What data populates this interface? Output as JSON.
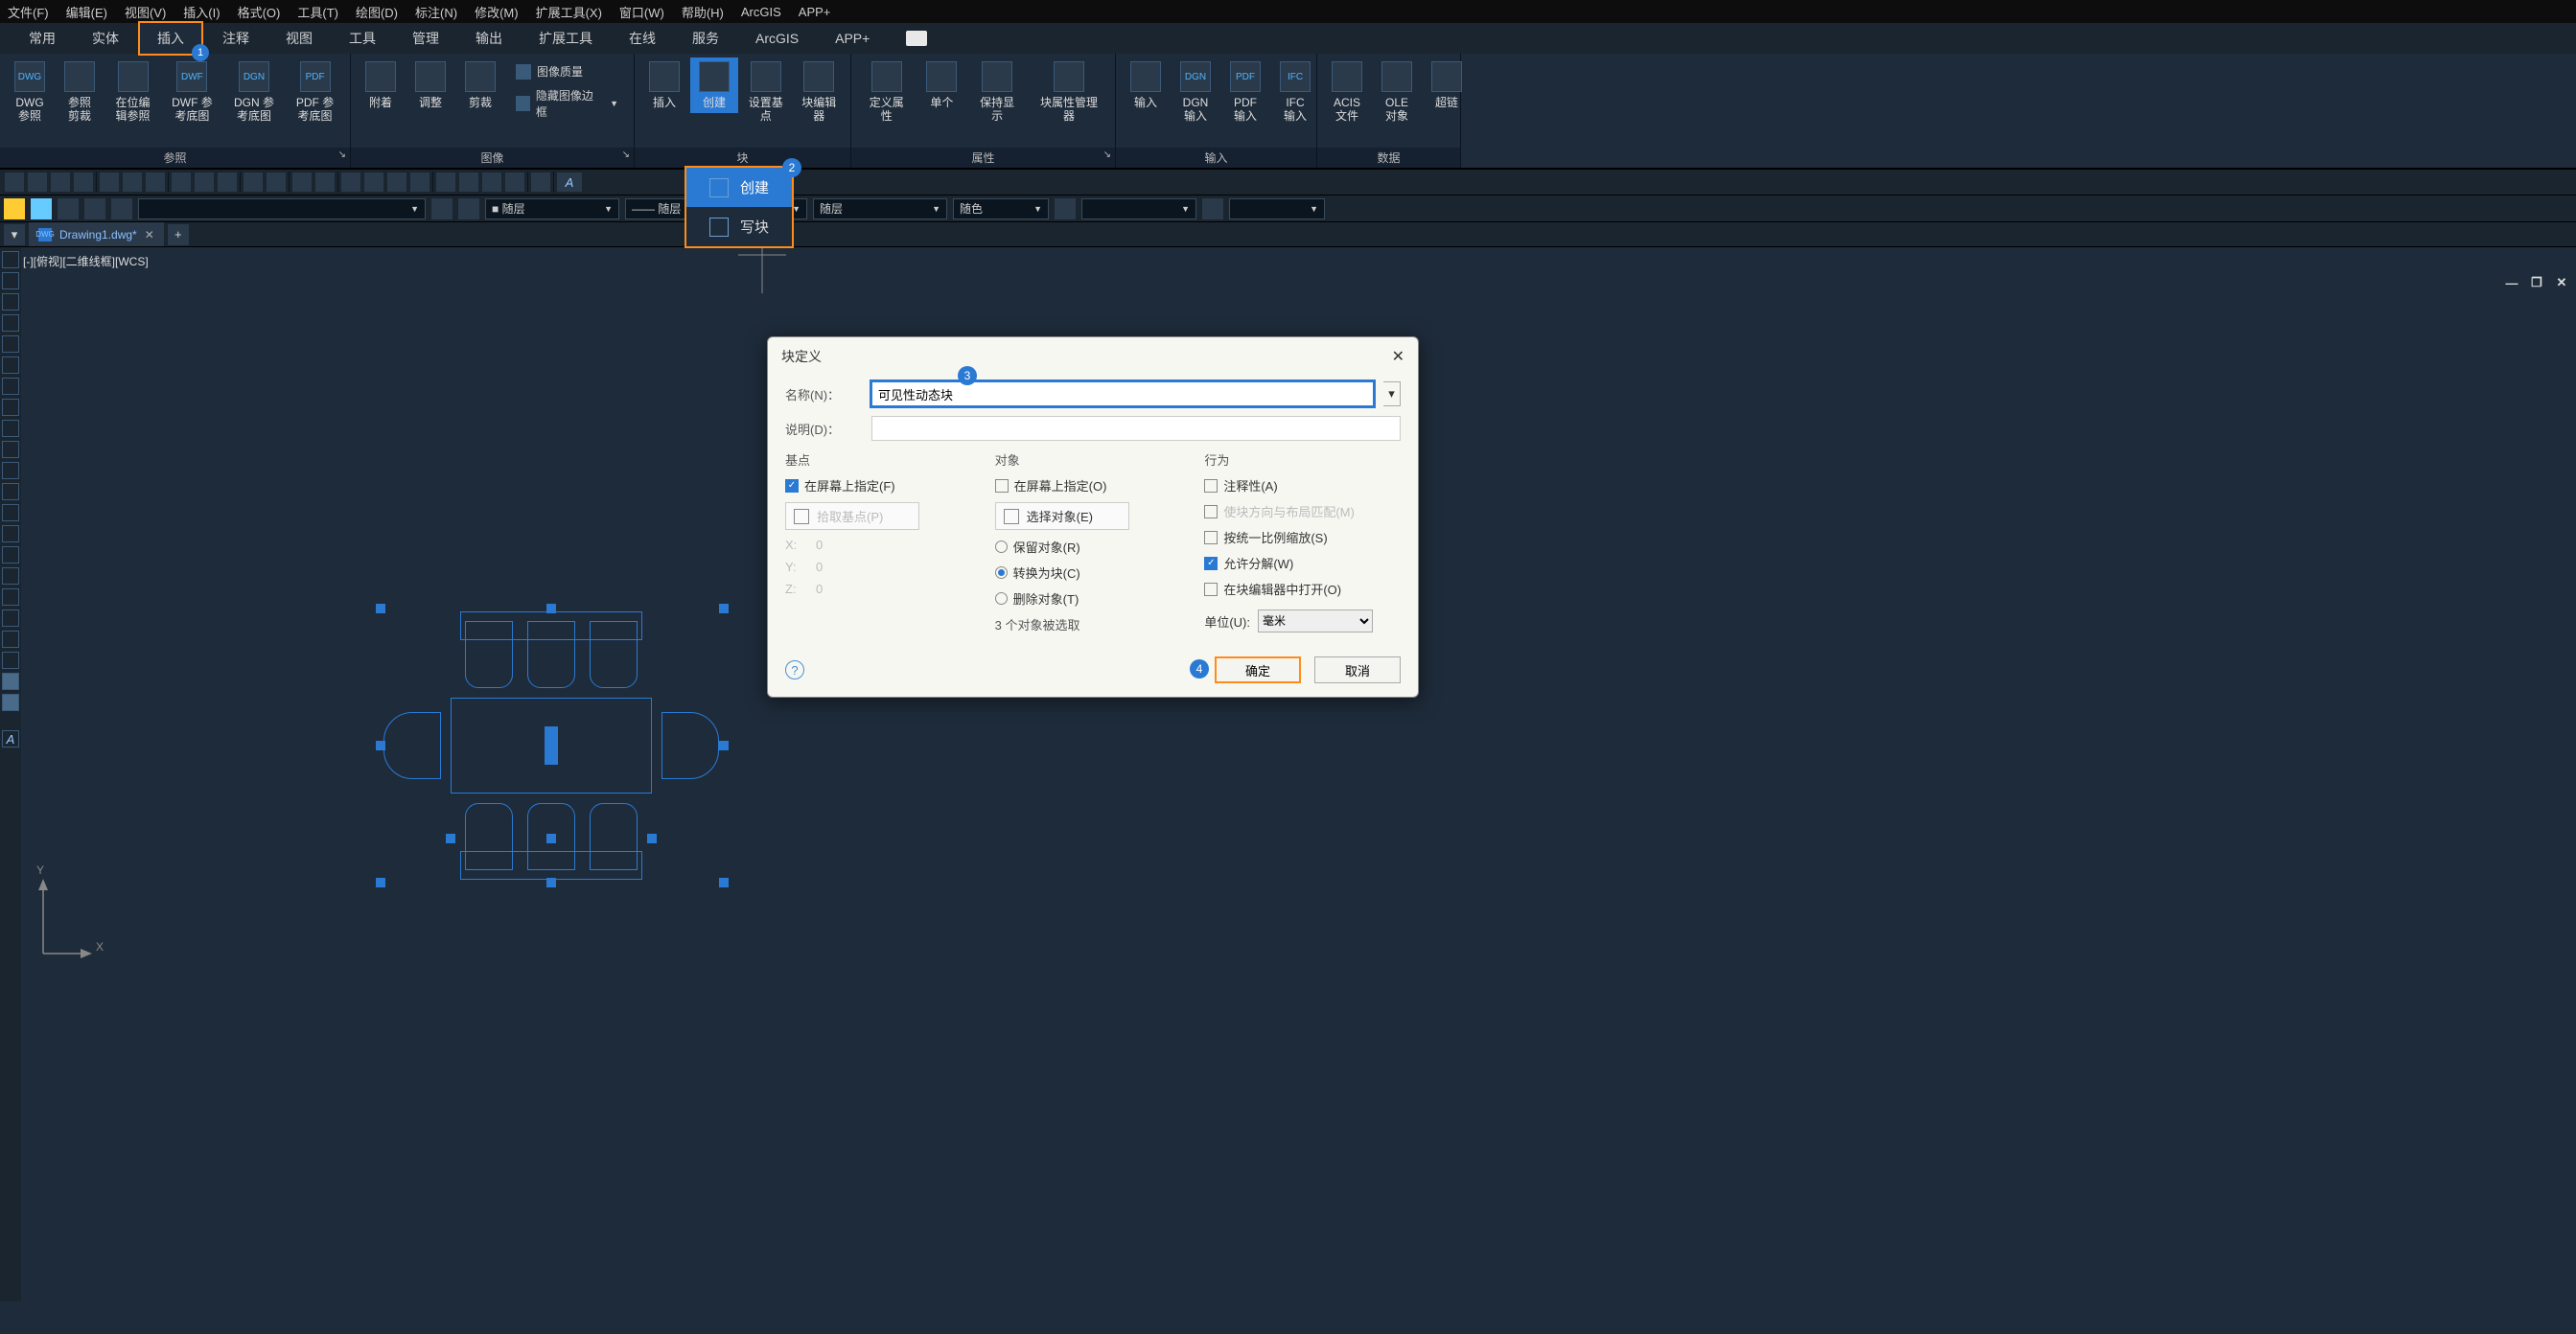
{
  "menubar": [
    "文件(F)",
    "编辑(E)",
    "视图(V)",
    "插入(I)",
    "格式(O)",
    "工具(T)",
    "绘图(D)",
    "标注(N)",
    "修改(M)",
    "扩展工具(X)",
    "窗口(W)",
    "帮助(H)",
    "ArcGIS",
    "APP+"
  ],
  "ribbon_tabs": [
    "常用",
    "实体",
    "插入",
    "注释",
    "视图",
    "工具",
    "管理",
    "输出",
    "扩展工具",
    "在线",
    "服务",
    "ArcGIS",
    "APP+"
  ],
  "active_ribbon_tab_index": 2,
  "highlighted_ribbon_tab_index": 2,
  "ribbon_panels": {
    "reference": {
      "title": "参照",
      "items": [
        {
          "icon": "DWG",
          "label": "DWG\n参照"
        },
        {
          "icon": "CLIP",
          "label": "参照剪裁"
        },
        {
          "icon": "EDIT",
          "label": "在位编辑参照"
        },
        {
          "icon": "DWF",
          "label": "DWF 参\n考底图"
        },
        {
          "icon": "DGN",
          "label": "DGN 参\n考底图"
        },
        {
          "icon": "PDF",
          "label": "PDF 参\n考底图"
        }
      ]
    },
    "image": {
      "title": "图像",
      "items": [
        {
          "icon": "ATT",
          "label": "附着"
        },
        {
          "icon": "ADJ",
          "label": "调整"
        },
        {
          "icon": "CLP",
          "label": "剪裁"
        }
      ],
      "small": [
        "图像质量",
        "隐藏图像边框"
      ]
    },
    "block": {
      "title": "块",
      "items": [
        {
          "icon": "INS",
          "label": "插入"
        },
        {
          "icon": "CRE",
          "label": "创建",
          "active": true
        },
        {
          "icon": "BAS",
          "label": "设置基点"
        },
        {
          "icon": "BED",
          "label": "块编辑器"
        }
      ]
    },
    "attr": {
      "title": "属性",
      "items": [
        {
          "icon": "DEF",
          "label": "定义属性"
        },
        {
          "icon": "SNG",
          "label": "单个"
        },
        {
          "icon": "KEEP",
          "label": "保持显示"
        },
        {
          "icon": "MGR",
          "label": "块属性管理器"
        }
      ]
    },
    "input": {
      "title": "输入",
      "items": [
        {
          "icon": "IMP",
          "label": "输入"
        },
        {
          "icon": "DGN",
          "label": "DGN\n输入"
        },
        {
          "icon": "PDF",
          "label": "PDF\n输入"
        },
        {
          "icon": "IFC",
          "label": "IFC\n输入"
        }
      ]
    },
    "data_panel": {
      "title": "数据",
      "items": [
        {
          "icon": "ACIS",
          "label": "ACIS\n文件"
        },
        {
          "icon": "OLE",
          "label": "OLE\n对象"
        },
        {
          "icon": "HYP",
          "label": "超链"
        }
      ]
    }
  },
  "dropdown": {
    "items": [
      {
        "icon": "c",
        "label": "创建",
        "active": true
      },
      {
        "icon": "w",
        "label": "写块"
      }
    ],
    "badge": "2"
  },
  "layerbar": {
    "sel1": "随层",
    "sel2": "随层",
    "sel3": "随层",
    "sel4": "随色"
  },
  "doc_tab": {
    "name": "Drawing1.dwg*"
  },
  "viewport_label": "[-][俯视][二维线框][WCS]",
  "ucs": {
    "x": "X",
    "y": "Y"
  },
  "dialog": {
    "title": "块定义",
    "name_label": "名称(N)：",
    "name_value": "可见性动态块",
    "desc_label": "说明(D)：",
    "groups": {
      "base": {
        "title": "基点",
        "specify_on_screen": "在屏幕上指定(F)",
        "specify_checked": true,
        "pick_button": "拾取基点(P)",
        "x_label": "X:",
        "x_value": "0",
        "y_label": "Y:",
        "y_value": "0",
        "z_label": "Z:",
        "z_value": "0"
      },
      "object": {
        "title": "对象",
        "specify_on_screen": "在屏幕上指定(O)",
        "specify_checked": false,
        "select_button": "选择对象(E)",
        "retain": "保留对象(R)",
        "convert": "转换为块(C)",
        "delete": "删除对象(T)",
        "selected_radio": "convert",
        "selected_count": "3 个对象被选取"
      },
      "behavior": {
        "title": "行为",
        "annotative": "注释性(A)",
        "match_orient": "使块方向与布局匹配(M)",
        "uniform_scale": "按统一比例缩放(S)",
        "allow_explode": "允许分解(W)",
        "open_in_editor": "在块编辑器中打开(O)",
        "unit_label": "单位(U):",
        "unit_value": "毫米",
        "allow_explode_checked": true
      }
    },
    "ok": "确定",
    "cancel": "取消",
    "name_badge": "3",
    "ok_badge": "4"
  },
  "highlight_badge_1": "1"
}
